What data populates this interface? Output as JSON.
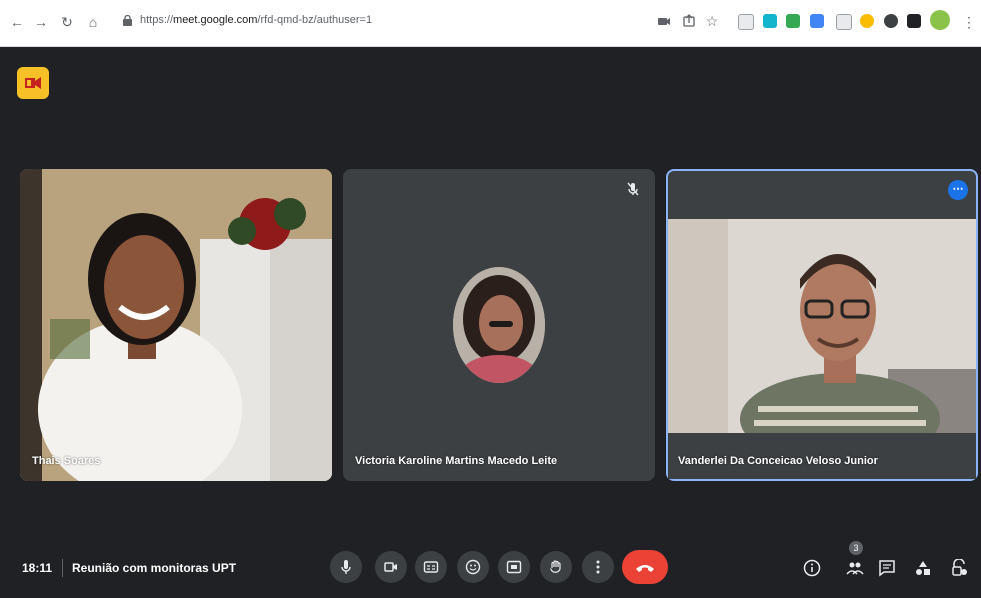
{
  "browser": {
    "url_prefix": "https://",
    "url_domain": "meet.google.com",
    "url_path": "/rfd-qmd-bz/authuser=1"
  },
  "tiles": [
    {
      "name": "Thais Soares"
    },
    {
      "name": "Victoria Karoline Martins Macedo Leite"
    },
    {
      "name": "Vanderlei Da Conceicao Veloso Junior"
    }
  ],
  "footer": {
    "time": "18:11",
    "meeting_title": "Reunião com monitoras UPT",
    "participant_count": "3"
  },
  "colors": {
    "background": "#202124",
    "tile": "#3c4043",
    "end_call": "#ea4335",
    "active_border": "#8ab4f8",
    "accent": "#1a73e8",
    "logo": "#f6c026"
  },
  "icons": [
    "back-icon",
    "forward-icon",
    "reload-icon",
    "home-icon",
    "lock-icon",
    "camera-icon",
    "share-icon",
    "star-icon",
    "extension-icons",
    "microphone-icon",
    "video-icon",
    "captions-icon",
    "emoji-icon",
    "present-icon",
    "raise-hand-icon",
    "more-options-icon",
    "end-call-icon",
    "info-icon",
    "people-icon",
    "chat-icon",
    "activities-icon",
    "host-controls-icon"
  ]
}
